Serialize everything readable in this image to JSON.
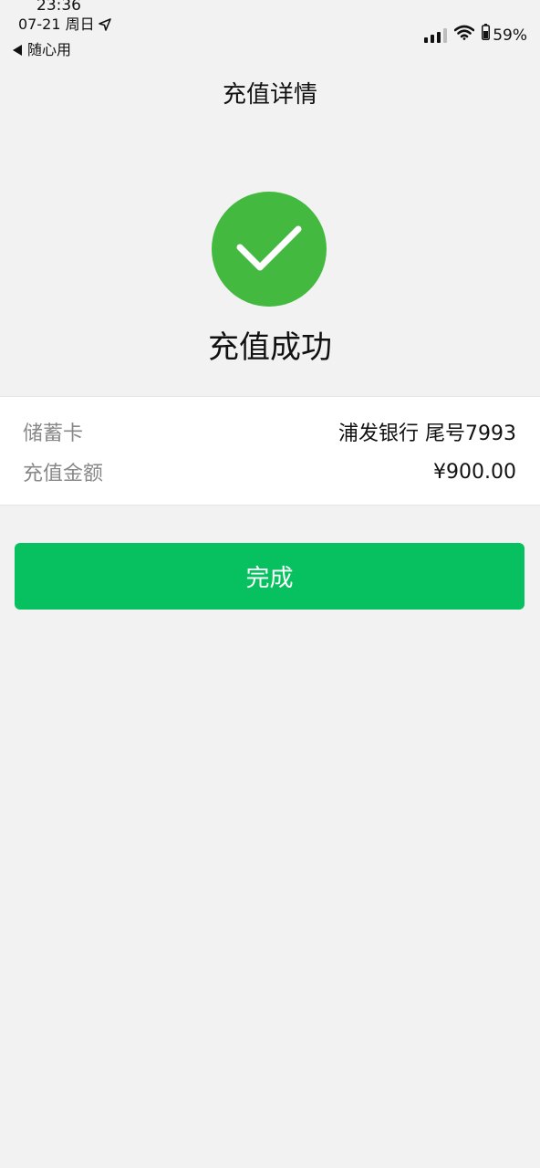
{
  "status_bar": {
    "time": "23:36",
    "date": "07-21 周日",
    "back_app": "随心用",
    "battery": "59%"
  },
  "nav": {
    "title": "充值详情"
  },
  "result": {
    "icon": "success-check-icon",
    "text": "充值成功",
    "icon_color": "#43b93f"
  },
  "details": [
    {
      "label": "储蓄卡",
      "value": "浦发银行 尾号7993"
    },
    {
      "label": "充值金额",
      "value": "¥900.00"
    }
  ],
  "actions": {
    "done_label": "完成",
    "done_color": "#07c160"
  }
}
